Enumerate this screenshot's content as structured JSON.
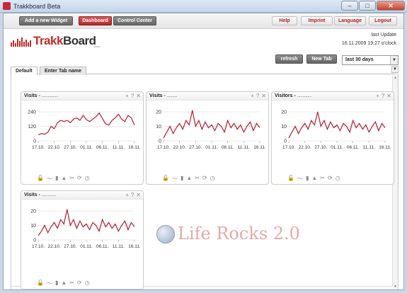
{
  "window": {
    "title": "Trakkboard Beta",
    "min_glyph": "–",
    "max_glyph": "□",
    "close_glyph": "✕"
  },
  "toolbar": {
    "add_widget": "Add a new Widget",
    "dashboard": "Dashboard",
    "control_center": "Control Center",
    "help": "Help",
    "imprint": "Imprint",
    "language": "Language",
    "logout": "Logout"
  },
  "logo": {
    "text_red": "Trakk",
    "text_dark": "Board",
    "sub": "beta"
  },
  "update": {
    "label": "last Update",
    "time": "16.11.2009 19:27 o'clock"
  },
  "actions": {
    "refresh": "refresh",
    "new_tab": "New Tab",
    "range": "last 30 days"
  },
  "tabs": [
    {
      "label": "Default"
    },
    {
      "label": "Enter Tab name"
    }
  ],
  "widgets": [
    {
      "title": "Visits - ",
      "sub": "................",
      "yticks": [
        240,
        120,
        0
      ],
      "xticks": [
        "17.10.",
        "22.10.",
        "27.10.",
        "01.11.",
        "06.11.",
        "11.11.",
        "16.11."
      ],
      "series": [
        50,
        60,
        55,
        70,
        120,
        100,
        150,
        170,
        160,
        170,
        150,
        180,
        190,
        170,
        210,
        175,
        160,
        180,
        200,
        230,
        185,
        140,
        130,
        170,
        190,
        220,
        180,
        160,
        210,
        190,
        130
      ]
    },
    {
      "title": "Visits - ",
      "sub": "..........",
      "yticks": [
        20,
        10,
        0
      ],
      "xticks": [
        "17.10.",
        "22.10.",
        "27.10.",
        "01.11.",
        "06.11.",
        "11.11.",
        "16.11."
      ],
      "series": [
        2,
        6,
        10,
        5,
        9,
        12,
        8,
        14,
        11,
        21,
        10,
        14,
        8,
        13,
        9,
        11,
        7,
        12,
        10,
        6,
        14,
        9,
        12,
        8,
        11,
        6,
        10,
        13,
        7,
        12,
        9
      ]
    },
    {
      "title": "Visitors - ",
      "sub": "..............",
      "yticks": [
        20,
        10,
        0
      ],
      "xticks": [
        "17.10.",
        "22.10.",
        "27.10.",
        "01.11.",
        "06.11.",
        "11.11.",
        "16.11."
      ],
      "series": [
        2,
        6,
        10,
        5,
        9,
        12,
        8,
        14,
        11,
        20,
        10,
        14,
        8,
        13,
        9,
        11,
        7,
        12,
        10,
        6,
        14,
        9,
        12,
        8,
        11,
        6,
        10,
        13,
        7,
        12,
        9
      ]
    },
    {
      "title": "Visits - ",
      "sub": "..............",
      "yticks": [
        20,
        10,
        0
      ],
      "xticks": [
        "17.10.",
        "22.10.",
        "27.10.",
        "01.11.",
        "06.11.",
        "11.11.",
        "16.11."
      ],
      "series": [
        3,
        6,
        10,
        5,
        9,
        12,
        8,
        14,
        11,
        21,
        10,
        14,
        8,
        13,
        9,
        11,
        7,
        12,
        10,
        6,
        14,
        9,
        12,
        8,
        11,
        6,
        10,
        13,
        7,
        12,
        9
      ]
    }
  ],
  "widget_icons": {
    "add": "+",
    "help": "?",
    "close": "✕",
    "lock": "🔓",
    "line": "〜",
    "bar": "▮",
    "area": "▲",
    "tools": "✂",
    "refresh": "⟳",
    "timer": "◷"
  },
  "watermark": {
    "text": "Life Rocks 2.0"
  },
  "colors": {
    "line": "#b21f2d",
    "grid": "#d6d6d6"
  }
}
